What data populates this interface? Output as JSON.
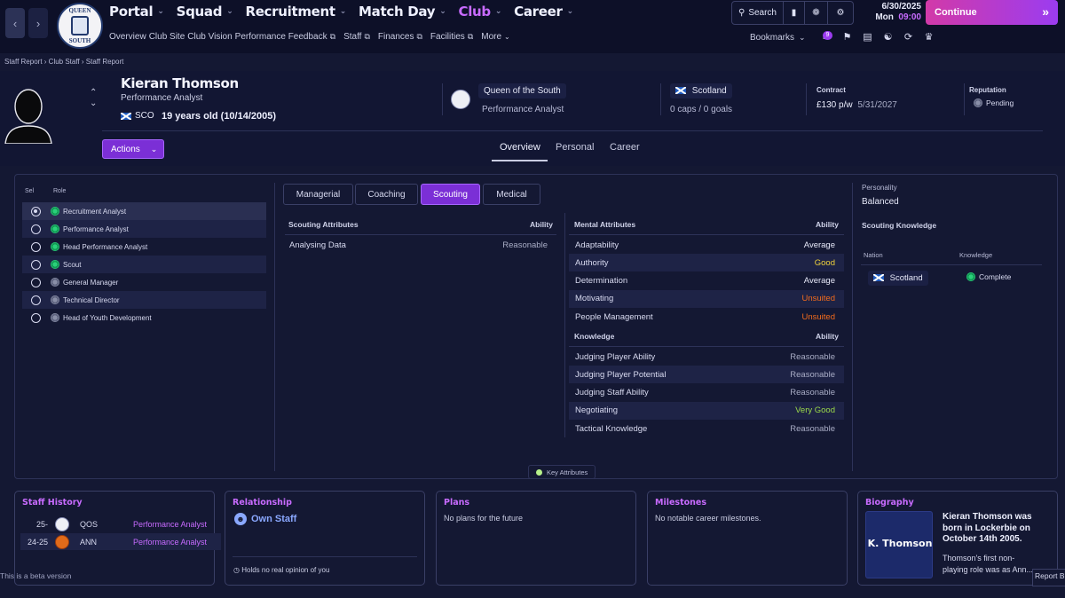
{
  "nav": {
    "back_icon": "chevron-left-icon",
    "forward_icon": "chevron-right-icon",
    "crest": {
      "top": "QUEEN",
      "side_left": "of",
      "side_right": "the",
      "bottom": "SOUTH"
    },
    "main": [
      "Portal",
      "Squad",
      "Recruitment",
      "Match Day",
      "Club",
      "Career"
    ],
    "active_main": "Club",
    "sub": [
      "Overview",
      "Club Site",
      "Club Vision",
      "Performance Feedback",
      "Staff",
      "Finances",
      "Facilities",
      "More"
    ],
    "search_label": "Search",
    "date": "6/30/2025",
    "day": "Mon",
    "time": "09:00",
    "continue_label": "Continue",
    "bookmarks_label": "Bookmarks",
    "inbox_count": "9"
  },
  "breadcrumb": [
    "Staff Report",
    "Club Staff",
    "Staff Report"
  ],
  "profile": {
    "name": "Kieran Thomson",
    "role": "Performance Analyst",
    "nation_code": "SCO",
    "age": "19 years old (10/14/2005)",
    "club": "Queen of the South",
    "club_role": "Performance Analyst",
    "nation": "Scotland",
    "caps": "0 caps / 0 goals",
    "contract_label": "Contract",
    "wage": "£130 p/w",
    "contract_end": "5/31/2027",
    "reputation_label": "Reputation",
    "reputation": "Pending",
    "actions_label": "Actions"
  },
  "tabs": [
    "Overview",
    "Personal",
    "Career"
  ],
  "active_tab": "Overview",
  "roles": {
    "sel_header": "Sel",
    "role_header": "Role",
    "items": [
      {
        "label": "Recruitment Analyst",
        "selected": true,
        "icon": "green"
      },
      {
        "label": "Performance Analyst",
        "selected": false,
        "icon": "green"
      },
      {
        "label": "Head Performance Analyst",
        "selected": false,
        "icon": "green"
      },
      {
        "label": "Scout",
        "selected": false,
        "icon": "green"
      },
      {
        "label": "General Manager",
        "selected": false,
        "icon": "grey"
      },
      {
        "label": "Technical Director",
        "selected": false,
        "icon": "grey"
      },
      {
        "label": "Head of Youth Development",
        "selected": false,
        "icon": "grey"
      }
    ]
  },
  "subtabs": [
    "Managerial",
    "Coaching",
    "Scouting",
    "Medical"
  ],
  "active_subtab": "Scouting",
  "scouting": {
    "header": "Scouting Attributes",
    "ability_header": "Ability",
    "rows": [
      {
        "label": "Analysing Data",
        "value": "Reasonable"
      }
    ]
  },
  "mental": {
    "header": "Mental Attributes",
    "ability_header": "Ability",
    "rows": [
      {
        "label": "Adaptability",
        "value": "Average",
        "tone": "avg"
      },
      {
        "label": "Authority",
        "value": "Good",
        "tone": "good"
      },
      {
        "label": "Determination",
        "value": "Average",
        "tone": "avg"
      },
      {
        "label": "Motivating",
        "value": "Unsuited",
        "tone": "uns"
      },
      {
        "label": "People Management",
        "value": "Unsuited",
        "tone": "uns"
      }
    ]
  },
  "knowledge": {
    "header": "Knowledge",
    "ability_header": "Ability",
    "rows": [
      {
        "label": "Judging Player Ability",
        "value": "Reasonable",
        "tone": "rea"
      },
      {
        "label": "Judging Player Potential",
        "value": "Reasonable",
        "tone": "rea"
      },
      {
        "label": "Judging Staff Ability",
        "value": "Reasonable",
        "tone": "rea"
      },
      {
        "label": "Negotiating",
        "value": "Very Good",
        "tone": "vg"
      },
      {
        "label": "Tactical Knowledge",
        "value": "Reasonable",
        "tone": "rea"
      }
    ]
  },
  "key_attributes_label": "Key Attributes",
  "personality": {
    "label": "Personality",
    "value": "Balanced"
  },
  "scouting_knowledge": {
    "title": "Scouting Knowledge",
    "nation_header": "Nation",
    "knowledge_header": "Knowledge",
    "nation": "Scotland",
    "level": "Complete"
  },
  "cards": {
    "staff_history": {
      "title": "Staff History",
      "rows": [
        {
          "years": "25-",
          "club": "QOS",
          "role": "Performance Analyst"
        },
        {
          "years": "24-25",
          "club": "ANN",
          "role": "Performance Analyst"
        }
      ]
    },
    "relationship": {
      "title": "Relationship",
      "status": "Own Staff",
      "note": "Holds no real opinion of you"
    },
    "plans": {
      "title": "Plans",
      "text": "No plans for the future"
    },
    "milestones": {
      "title": "Milestones",
      "text": "No notable career milestones."
    },
    "biography": {
      "title": "Biography",
      "badge": "K. Thomson",
      "headline": "Kieran Thomson was born in Lockerbie on October 14th 2005.",
      "body": "Thomson's first non-playing role was as Ann..."
    }
  },
  "beta_note": "This is a beta version",
  "report_bug": "Report Bu",
  "colors": {
    "accent": "#c86bff",
    "button": "#7b2fd6",
    "good": "#f0d23c",
    "unsuited": "#f26b1d",
    "very_good": "#9bd94a"
  }
}
